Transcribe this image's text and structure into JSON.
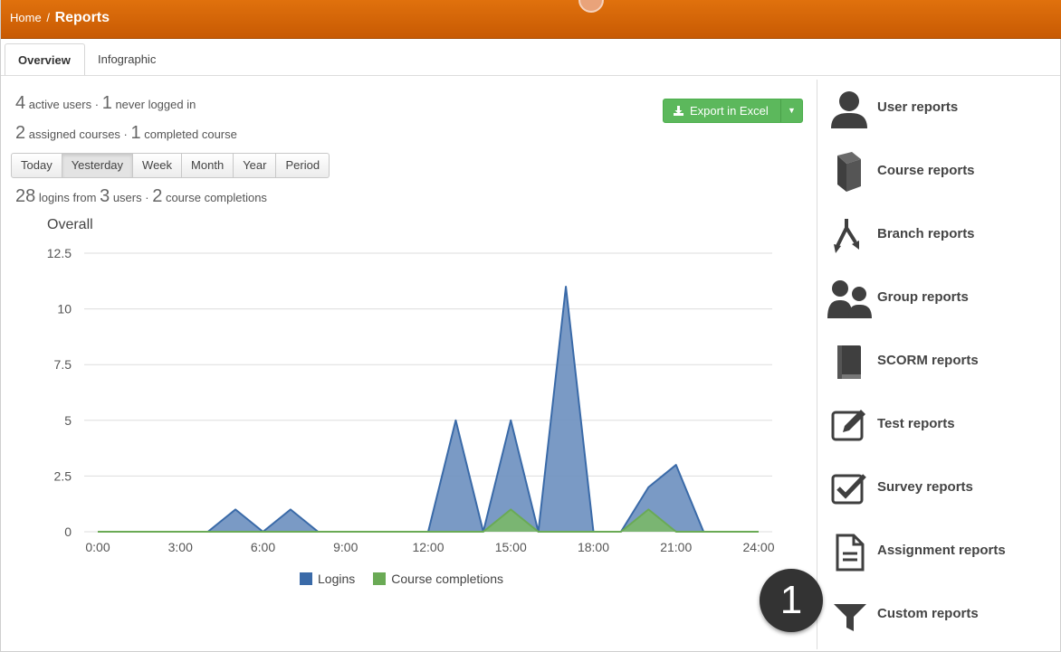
{
  "breadcrumb": {
    "home": "Home",
    "separator": "/",
    "current": "Reports"
  },
  "tabs": [
    {
      "label": "Overview",
      "active": true
    },
    {
      "label": "Infographic",
      "active": false
    }
  ],
  "stats": {
    "active_users": "4",
    "active_users_label": "active users ·",
    "never_logged": "1",
    "never_logged_label": "never logged in",
    "assigned_courses": "2",
    "assigned_courses_label": "assigned courses ·",
    "completed_courses": "1",
    "completed_courses_label": "completed course",
    "logins": "28",
    "logins_label": "logins from",
    "users": "3",
    "users_label": "users ·",
    "completions": "2",
    "completions_label": "course completions"
  },
  "export": {
    "label": "Export in Excel",
    "icon": "download-icon",
    "caret_icon": "caret-down-icon",
    "color": "#5cb85c"
  },
  "periods": [
    {
      "label": "Today",
      "active": false
    },
    {
      "label": "Yesterday",
      "active": true
    },
    {
      "label": "Week",
      "active": false
    },
    {
      "label": "Month",
      "active": false
    },
    {
      "label": "Year",
      "active": false
    },
    {
      "label": "Period",
      "active": false
    }
  ],
  "chart_data": {
    "type": "area",
    "title": "Overall",
    "x": [
      0,
      1,
      2,
      3,
      4,
      5,
      6,
      7,
      8,
      9,
      10,
      11,
      12,
      13,
      14,
      15,
      16,
      17,
      18,
      19,
      20,
      21,
      22,
      23,
      24
    ],
    "x_ticks": [
      "0:00",
      "3:00",
      "6:00",
      "9:00",
      "12:00",
      "15:00",
      "18:00",
      "21:00",
      "24:00"
    ],
    "y_ticks": [
      "0",
      "2.5",
      "5",
      "7.5",
      "10",
      "12.5"
    ],
    "ylim": [
      0,
      12.5
    ],
    "xlim": [
      0,
      24
    ],
    "grid": true,
    "legend_position": "bottom",
    "series": [
      {
        "name": "Logins",
        "color": "#3a6aa8",
        "fill": "#6b8fbf",
        "values": [
          0,
          0,
          0,
          0,
          0,
          1,
          0,
          1,
          0,
          0,
          0,
          0,
          0,
          5,
          0,
          5,
          0,
          11,
          0,
          0,
          2,
          3,
          0,
          0,
          0
        ]
      },
      {
        "name": "Course completions",
        "color": "#6aaa55",
        "fill": "#7ab868",
        "values": [
          0,
          0,
          0,
          0,
          0,
          0,
          0,
          0,
          0,
          0,
          0,
          0,
          0,
          0,
          0,
          1,
          0,
          0,
          0,
          0,
          1,
          0,
          0,
          0,
          0
        ]
      }
    ]
  },
  "reports": [
    {
      "label": "User reports",
      "icon": "user-icon"
    },
    {
      "label": "Course reports",
      "icon": "book-icon"
    },
    {
      "label": "Branch reports",
      "icon": "branch-icon"
    },
    {
      "label": "Group reports",
      "icon": "group-icon"
    },
    {
      "label": "SCORM reports",
      "icon": "scorm-book-icon"
    },
    {
      "label": "Test reports",
      "icon": "edit-icon"
    },
    {
      "label": "Survey reports",
      "icon": "checkbox-icon"
    },
    {
      "label": "Assignment reports",
      "icon": "document-icon"
    },
    {
      "label": "Custom reports",
      "icon": "filter-icon"
    }
  ],
  "badge": {
    "label": "1"
  },
  "colors": {
    "topbar": "#d7680a",
    "accent_text": "#444444"
  }
}
